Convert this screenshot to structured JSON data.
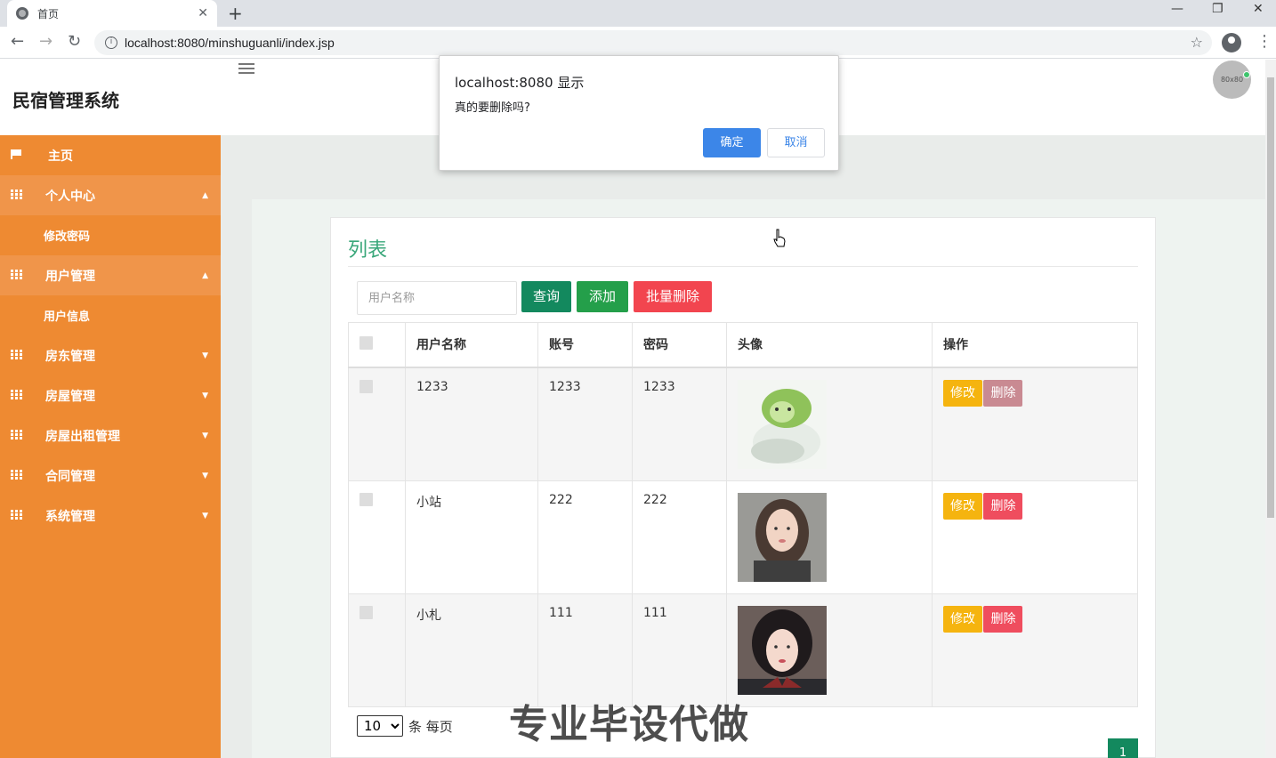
{
  "browser": {
    "tab_title": "首页",
    "url": "localhost:8080/minshuguanli/index.jsp"
  },
  "app": {
    "brand": "民宿管理系统",
    "avatar_text": "80x80"
  },
  "sidebar": {
    "home": "主页",
    "personal": "个人中心",
    "personal_sub": "修改密码",
    "users": "用户管理",
    "users_sub": "用户信息",
    "landlords": "房东管理",
    "houses": "房屋管理",
    "rentals": "房屋出租管理",
    "contracts": "合同管理",
    "system": "系统管理"
  },
  "panel": {
    "title": "列表",
    "search_placeholder": "用户名称",
    "query_btn": "查询",
    "add_btn": "添加",
    "batch_delete_btn": "批量删除"
  },
  "table": {
    "headers": [
      "用户名称",
      "账号",
      "密码",
      "头像",
      "操作"
    ],
    "rows": [
      {
        "name": "1233",
        "account": "1233",
        "password": "1233",
        "avatar": "cabbage-dog-image"
      },
      {
        "name": "小站",
        "account": "222",
        "password": "222",
        "avatar": "woman-portrait-1"
      },
      {
        "name": "小札",
        "account": "111",
        "password": "111",
        "avatar": "woman-portrait-2"
      }
    ],
    "edit_label": "修改",
    "delete_label": "删除"
  },
  "pagination": {
    "page_size": "10",
    "per_page_text": "条 每页",
    "current_page": "1"
  },
  "dialog": {
    "title": "localhost:8080 显示",
    "message": "真的要删除吗?",
    "ok": "确定",
    "cancel": "取消"
  },
  "watermark": "专业毕设代做",
  "colors": {
    "sidebar": "#ee8a32",
    "accent_green": "#13895e",
    "danger": "#f2454f",
    "warning": "#f5b40f",
    "dialog_blue": "#3c86e8"
  }
}
